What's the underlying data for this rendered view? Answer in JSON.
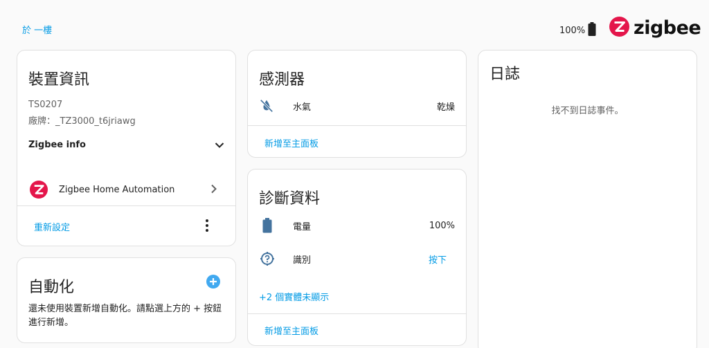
{
  "header": {
    "area_link": "於 一樓",
    "battery_level": "100%",
    "brand_name": "zigbee",
    "brand_color": "#e4164b"
  },
  "device_info": {
    "title": "裝置資訊",
    "model": "TS0207",
    "manufacturer": "廠牌：_TZ3000_t6jriawg",
    "zigbee_info_label": "Zigbee info",
    "integration_name": "Zigbee Home Automation",
    "reconfigure_label": "重新設定"
  },
  "automation": {
    "title": "自動化",
    "empty_text": "還未使用裝置新增自動化。請點選上方的 + 按鈕進行新增。"
  },
  "sensors": {
    "title": "感測器",
    "items": [
      {
        "icon": "water-off-icon",
        "name": "水氣",
        "value": "乾燥"
      }
    ],
    "add_to_dashboard": "新增至主面板"
  },
  "diagnostics": {
    "title": "診斷資料",
    "items": [
      {
        "icon": "battery-icon",
        "name": "電量",
        "value": "100%"
      },
      {
        "icon": "help-circle-icon",
        "name": "識別",
        "value": "按下"
      }
    ],
    "hidden_entities": "+2 個實體未顯示",
    "add_to_dashboard": "新增至主面板"
  },
  "logbook": {
    "title": "日誌",
    "empty_text": "找不到日誌事件。"
  },
  "colors": {
    "accent": "#039be5",
    "icon": "#44739e",
    "add_button": "#41a9f0"
  }
}
